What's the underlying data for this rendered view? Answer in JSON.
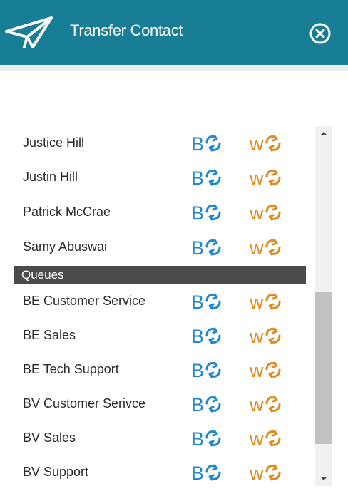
{
  "header": {
    "title": "Transfer Contact",
    "background_color": "#177e95",
    "icon": "paper-plane-icon",
    "close_icon": "close-circle-icon"
  },
  "transfer_buttons": {
    "blind_transfer": {
      "text": "B",
      "icon": "transfer-arrows-icon",
      "color": "#1f88d0"
    },
    "warm_transfer": {
      "text": "w",
      "icon": "transfer-arrows-icon",
      "color": "#e08b1f"
    }
  },
  "agents": [
    {
      "name": "Justice Hill"
    },
    {
      "name": "Justin Hill"
    },
    {
      "name": "Patrick McCrae"
    },
    {
      "name": "Samy Abuswai"
    }
  ],
  "queues_section": {
    "label": "Queues",
    "items": [
      {
        "name": "BE Customer Service"
      },
      {
        "name": "BE Sales"
      },
      {
        "name": "BE Tech Support"
      },
      {
        "name": "BV Customer Serivce"
      },
      {
        "name": "BV Sales"
      },
      {
        "name": "BV Support"
      }
    ]
  },
  "scrollbar": {
    "scroll_position": 0.86
  }
}
